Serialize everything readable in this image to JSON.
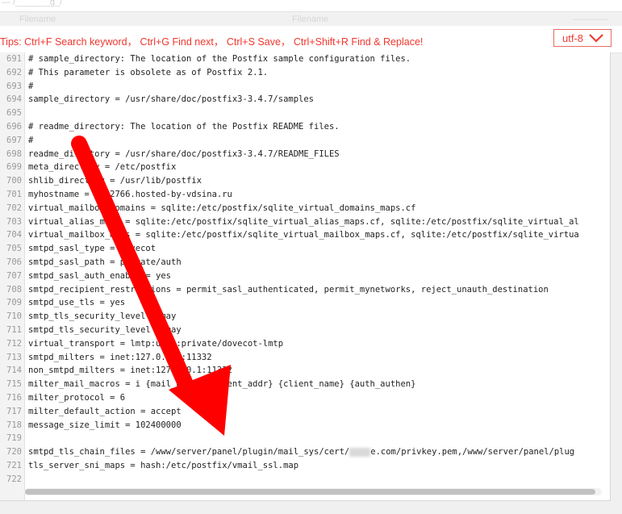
{
  "top_strip": {
    "left_text": "— /_______g_/",
    "right_text": ""
  },
  "tabs": [
    "Filename",
    "Filename",
    "————"
  ],
  "toolbar": {
    "tips": "Tips:  Ctrl+F Search keyword， Ctrl+G Find next， Ctrl+S Save， Ctrl+Shift+R Find & Replace!",
    "encoding": "utf-8"
  },
  "editor": {
    "lines": [
      {
        "num": "691",
        "code": "# sample_directory: The location of the Postfix sample configuration files."
      },
      {
        "num": "692",
        "code": "# This parameter is obsolete as of Postfix 2.1."
      },
      {
        "num": "693",
        "code": "#"
      },
      {
        "num": "694",
        "code": "sample_directory = /usr/share/doc/postfix3-3.4.7/samples"
      },
      {
        "num": "695",
        "code": ""
      },
      {
        "num": "696",
        "code": "# readme_directory: The location of the Postfix README files."
      },
      {
        "num": "697",
        "code": "#"
      },
      {
        "num": "698",
        "code": "readme_directory = /usr/share/doc/postfix3-3.4.7/README_FILES"
      },
      {
        "num": "699",
        "code": "meta_directory = /etc/postfix"
      },
      {
        "num": "700",
        "code": "shlib_directory = /usr/lib/postfix"
      },
      {
        "num": "701",
        "code": "myhostname = v112766.hosted-by-vdsina.ru"
      },
      {
        "num": "702",
        "code": "virtual_mailbox_domains = sqlite:/etc/postfix/sqlite_virtual_domains_maps.cf"
      },
      {
        "num": "703",
        "code": "virtual_alias_maps = sqlite:/etc/postfix/sqlite_virtual_alias_maps.cf, sqlite:/etc/postfix/sqlite_virtual_al"
      },
      {
        "num": "704",
        "code": "virtual_mailbox_maps = sqlite:/etc/postfix/sqlite_virtual_mailbox_maps.cf, sqlite:/etc/postfix/sqlite_virtua"
      },
      {
        "num": "705",
        "code": "smtpd_sasl_type = dovecot"
      },
      {
        "num": "706",
        "code": "smtpd_sasl_path = private/auth"
      },
      {
        "num": "707",
        "code": "smtpd_sasl_auth_enable = yes"
      },
      {
        "num": "708",
        "code": "smtpd_recipient_restrictions = permit_sasl_authenticated, permit_mynetworks, reject_unauth_destination"
      },
      {
        "num": "709",
        "code": "smtpd_use_tls = yes"
      },
      {
        "num": "710",
        "code": "smtp_tls_security_level = may"
      },
      {
        "num": "711",
        "code": "smtpd_tls_security_level = may"
      },
      {
        "num": "712",
        "code": "virtual_transport = lmtp:unix:private/dovecot-lmtp"
      },
      {
        "num": "713",
        "code": "smtpd_milters = inet:127.0.0.1:11332"
      },
      {
        "num": "714",
        "code": "non_smtpd_milters = inet:127.0.0.1:11332"
      },
      {
        "num": "715",
        "code": "milter_mail_macros = i {mail_addr} {client_addr} {client_name} {auth_authen}"
      },
      {
        "num": "716",
        "code": "milter_protocol = 6"
      },
      {
        "num": "717",
        "code": "milter_default_action = accept"
      },
      {
        "num": "718",
        "code": "message_size_limit = 102400000"
      },
      {
        "num": "719",
        "code": ""
      },
      {
        "num": "720",
        "code_before": "smtpd_tls_chain_files = /www/server/panel/plugin/mail_sys/cert/",
        "code_after": "e.com/privkey.pem,/www/server/panel/plug"
      },
      {
        "num": "721",
        "code": "tls_server_sni_maps = hash:/etc/postfix/vmail_ssl.map"
      },
      {
        "num": "722",
        "code": ""
      }
    ],
    "scroll_fraction_visible": 0.99
  },
  "colors": {
    "tips": "#f0372e",
    "encoding_border": "#e96b62",
    "arrow": "#ff0000"
  }
}
